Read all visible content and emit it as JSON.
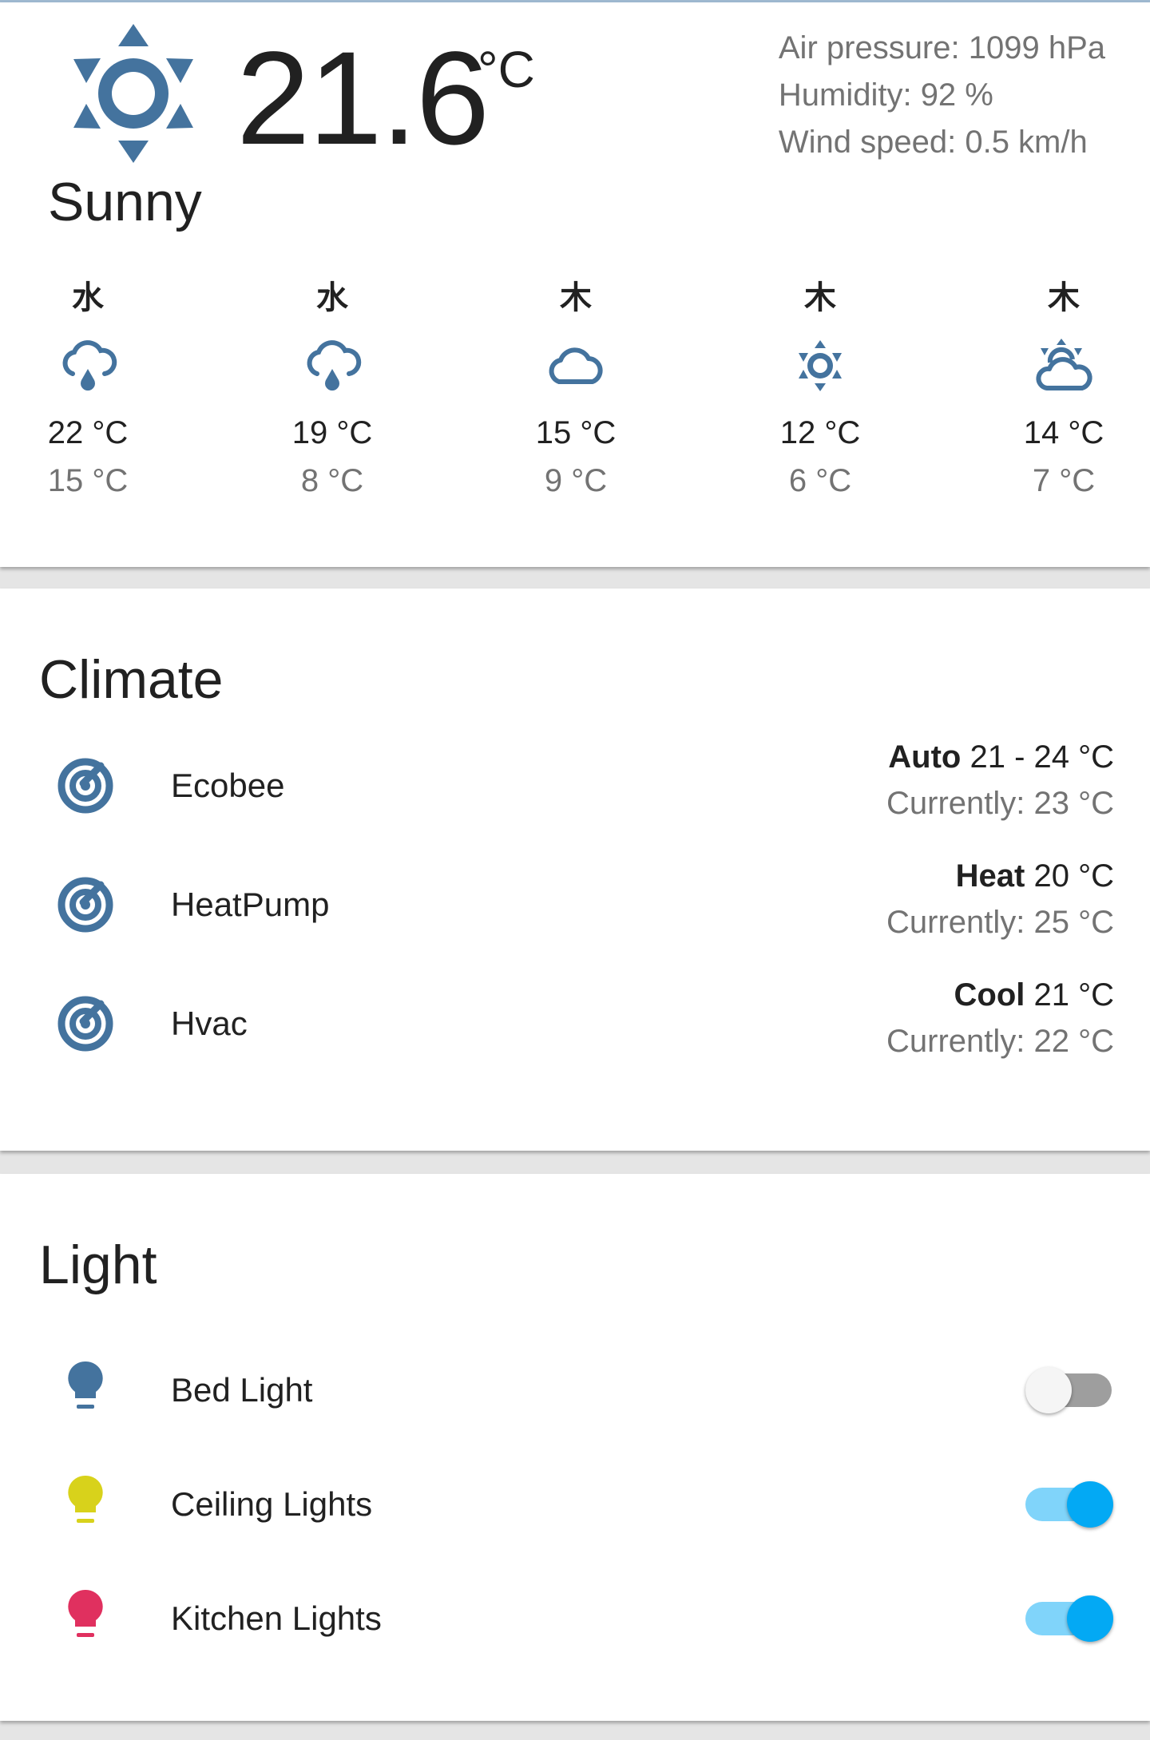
{
  "colors": {
    "icon_blue": "#44739e",
    "bulb_off": "#44739e",
    "bulb_yellow": "#d8d21b",
    "bulb_red": "#e0305f",
    "toggle_on": "#03a9f4"
  },
  "weather": {
    "icon": "sun-icon",
    "temperature": "21.6",
    "unit": "°C",
    "condition": "Sunny",
    "attributes": {
      "air_pressure": "Air pressure: 1099 hPa",
      "humidity": "Humidity: 92 %",
      "wind_speed": "Wind speed: 0.5 km/h"
    },
    "forecast": [
      {
        "day": "水",
        "icon": "rain-cloud-icon",
        "high": "22 °C",
        "low": "15 °C"
      },
      {
        "day": "水",
        "icon": "rain-cloud-icon",
        "high": "19 °C",
        "low": "8 °C"
      },
      {
        "day": "木",
        "icon": "cloud-icon",
        "high": "15 °C",
        "low": "9 °C"
      },
      {
        "day": "木",
        "icon": "sun-icon",
        "high": "12 °C",
        "low": "6 °C"
      },
      {
        "day": "木",
        "icon": "partly-cloudy-icon",
        "high": "14 °C",
        "low": "7 °C"
      }
    ]
  },
  "climate": {
    "title": "Climate",
    "items": [
      {
        "name": "Ecobee",
        "icon": "thermostat-icon",
        "mode": "Auto",
        "target": "21 - 24 °C",
        "current": "Currently: 23 °C"
      },
      {
        "name": "HeatPump",
        "icon": "thermostat-icon",
        "mode": "Heat",
        "target": "20 °C",
        "current": "Currently: 25 °C"
      },
      {
        "name": "Hvac",
        "icon": "thermostat-icon",
        "mode": "Cool",
        "target": "21 °C",
        "current": "Currently: 22 °C"
      }
    ]
  },
  "light": {
    "title": "Light",
    "items": [
      {
        "name": "Bed Light",
        "icon": "lightbulb-icon",
        "state": "off"
      },
      {
        "name": "Ceiling Lights",
        "icon": "lightbulb-icon",
        "state": "on"
      },
      {
        "name": "Kitchen Lights",
        "icon": "lightbulb-icon",
        "state": "on"
      }
    ]
  }
}
